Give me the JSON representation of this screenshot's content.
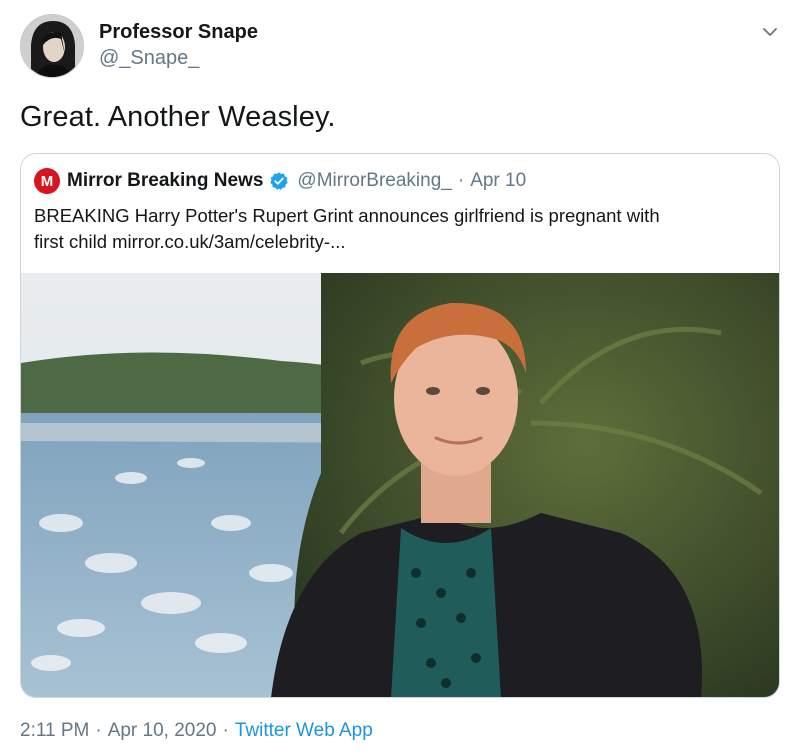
{
  "author": {
    "name": "Professor Snape",
    "handle": "@_Snape_"
  },
  "tweet": {
    "text": "Great. Another Weasley."
  },
  "quoted": {
    "name": "Mirror Breaking News",
    "handle": "@MirrorBreaking_",
    "separator": "·",
    "date": "Apr 10",
    "text_line1": "BREAKING Harry Potter's Rupert Grint announces girlfriend is pregnant with",
    "text_line2": "first child mirror.co.uk/3am/celebrity-...",
    "logo_letter": "M",
    "logo_color": "#d7141f",
    "verified_color": "#1da1f2"
  },
  "meta": {
    "time": "2:11 PM",
    "separator": "·",
    "date": "Apr 10, 2020",
    "source": "Twitter Web App"
  },
  "icons": {
    "caret": "chevron-down-icon",
    "verified": "verified-badge-icon"
  },
  "colors": {
    "text_primary": "#14171a",
    "text_secondary": "#657786",
    "link": "#1b95e0",
    "border": "#ccd6dd"
  }
}
